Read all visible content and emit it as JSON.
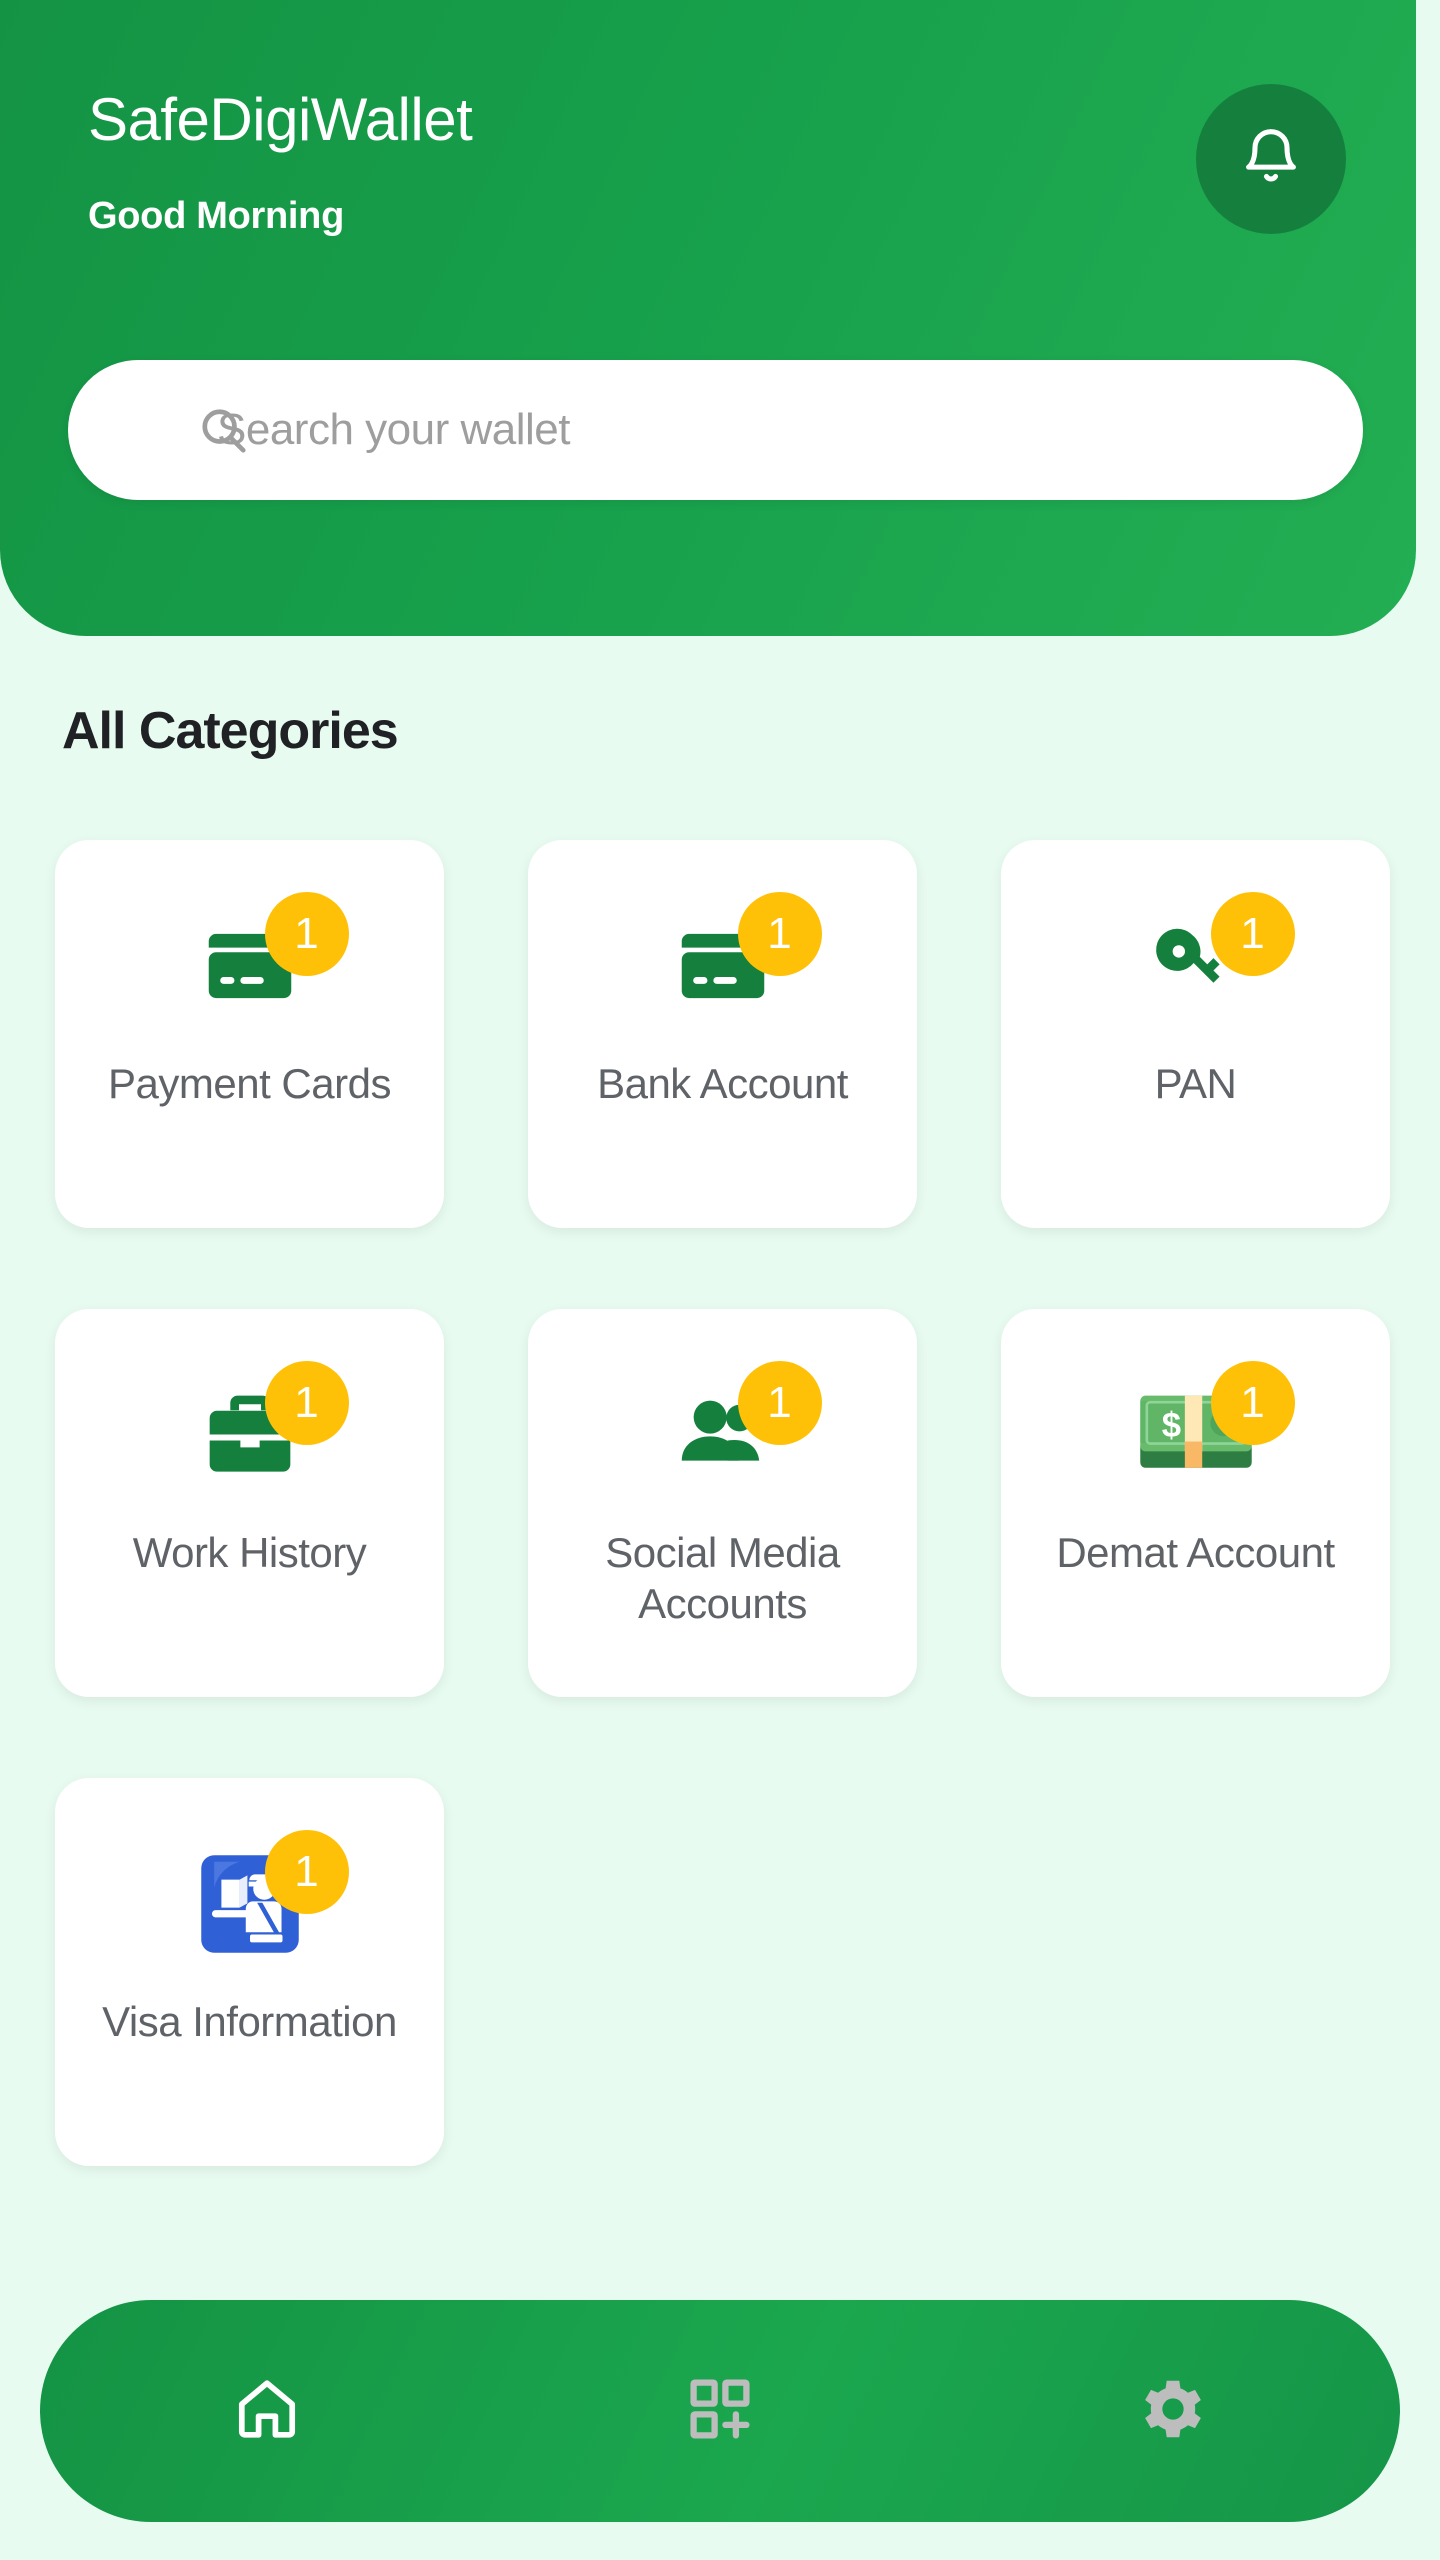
{
  "header": {
    "app_title": "SafeDigiWallet",
    "greeting": "Good Morning",
    "notification_icon": "bell-icon"
  },
  "search": {
    "icon": "search-icon",
    "placeholder": "Search your wallet",
    "value": ""
  },
  "main": {
    "section_title": "All Categories",
    "categories": [
      {
        "label": "Payment Cards",
        "count": "1",
        "icon": "credit-card-icon"
      },
      {
        "label": "Bank Account",
        "count": "1",
        "icon": "credit-card-icon"
      },
      {
        "label": "PAN",
        "count": "1",
        "icon": "key-icon"
      },
      {
        "label": "Work History",
        "count": "1",
        "icon": "briefcase-icon"
      },
      {
        "label": "Social Media Accounts",
        "count": "1",
        "icon": "people-group-icon"
      },
      {
        "label": "Demat Account",
        "count": "1",
        "icon": "banknote-emoji"
      },
      {
        "label": "Visa Information",
        "count": "1",
        "icon": "passport-control-emoji"
      }
    ]
  },
  "bottom_nav": {
    "items": [
      {
        "name": "home",
        "icon": "home-icon",
        "active": true
      },
      {
        "name": "scan-add",
        "icon": "qr-add-icon",
        "active": false
      },
      {
        "name": "settings",
        "icon": "gear-icon",
        "active": false
      }
    ]
  },
  "colors": {
    "brand_green": "#149344",
    "brand_green_light": "#23ae53",
    "badge_amber": "#ffc107",
    "page_background": "#e8fbf1",
    "card_white": "#ffffff",
    "label_gray": "#5f6368",
    "placeholder_gray": "#9e9e9e",
    "nav_inactive": "#bdbdbd",
    "visa_icon_blue": "#3060d6"
  }
}
